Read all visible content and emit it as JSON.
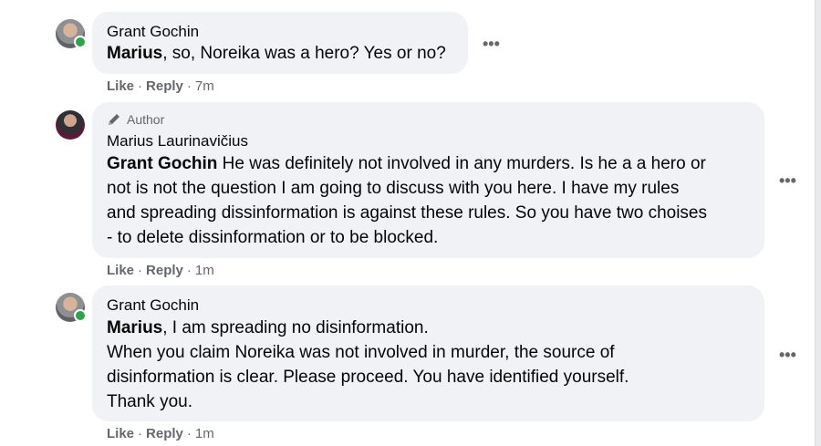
{
  "comments": [
    {
      "author": "Grant Gochin",
      "mention": "Marius",
      "paragraphs": [
        ", so, Noreika was a hero? Yes or no?"
      ],
      "like_label": "Like",
      "reply_label": "Reply",
      "time": "7m"
    },
    {
      "badge": "Author",
      "author": "Marius Laurinavičius",
      "mention": "Grant Gochin",
      "paragraphs": [
        " He was definitely not involved in any murders. Is he a a hero or",
        "not is not the question I am going to discuss with you here. I have my rules",
        "and spreading dissinformation is against these rules. So you have two choises",
        "- to delete dissinformation or to be blocked."
      ],
      "like_label": "Like",
      "reply_label": "Reply",
      "time": "1m"
    },
    {
      "author": "Grant Gochin",
      "mention": "Marius",
      "paragraphs": [
        ", I am spreading no disinformation.",
        "When you claim Noreika was not involved in murder, the source of",
        "disinformation is clear. Please proceed. You have identified yourself.",
        "Thank you."
      ],
      "like_label": "Like",
      "reply_label": "Reply",
      "time": "1m"
    }
  ],
  "more_label": "•••",
  "separator": "·",
  "colors": {
    "bubble": "#f0f2f5",
    "meta": "#65676b",
    "online": "#31a24c"
  }
}
